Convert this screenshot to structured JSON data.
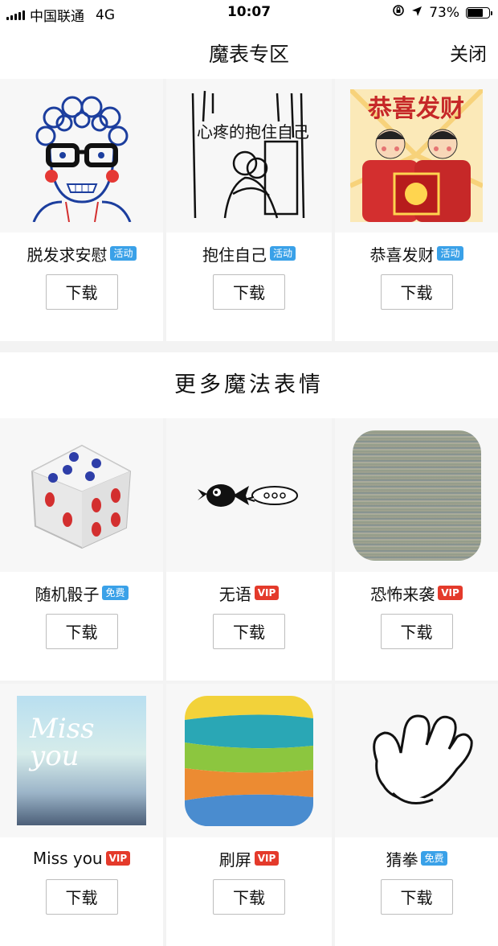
{
  "status": {
    "carrier": "中国联通",
    "network": "4G",
    "time": "10:07",
    "battery": "73%",
    "battery_level": 0.73
  },
  "header": {
    "title": "魔表专区",
    "close_label": "关闭"
  },
  "featured": [
    {
      "name": "脱发求安慰",
      "badge": "活动",
      "badge_color": "#3aa1e8",
      "button": "下载",
      "icon": "curly-hair-glasses-face"
    },
    {
      "name": "抱住自己",
      "badge": "活动",
      "badge_color": "#3aa1e8",
      "button": "下载",
      "icon": "hug-self-sketch",
      "image_text": "心疼的抱住自己"
    },
    {
      "name": "恭喜发财",
      "badge": "活动",
      "badge_color": "#3aa1e8",
      "button": "下载",
      "icon": "fortune-kids",
      "image_text": "恭喜发财"
    }
  ],
  "more_section": {
    "title": "更多魔法表情"
  },
  "more_items": [
    {
      "name": "随机骰子",
      "badge": "免费",
      "badge_color": "#3aa1e8",
      "button": "下载",
      "icon": "dice-icon"
    },
    {
      "name": "无语",
      "badge": "VIP",
      "badge_color": "#e43a2b",
      "button": "下载",
      "icon": "speechless-bird-icon"
    },
    {
      "name": "恐怖来袭",
      "badge": "VIP",
      "badge_color": "#e43a2b",
      "button": "下载",
      "icon": "static-noise-icon"
    },
    {
      "name": "Miss you",
      "badge": "VIP",
      "badge_color": "#e43a2b",
      "button": "下载",
      "icon": "miss-you-rain-icon",
      "image_text": "Miss you"
    },
    {
      "name": "刷屏",
      "badge": "VIP",
      "badge_color": "#e43a2b",
      "button": "下载",
      "icon": "paint-stripes-icon"
    },
    {
      "name": "猜拳",
      "badge": "免费",
      "badge_color": "#3aa1e8",
      "button": "下载",
      "icon": "cartoon-hand-icon"
    }
  ]
}
